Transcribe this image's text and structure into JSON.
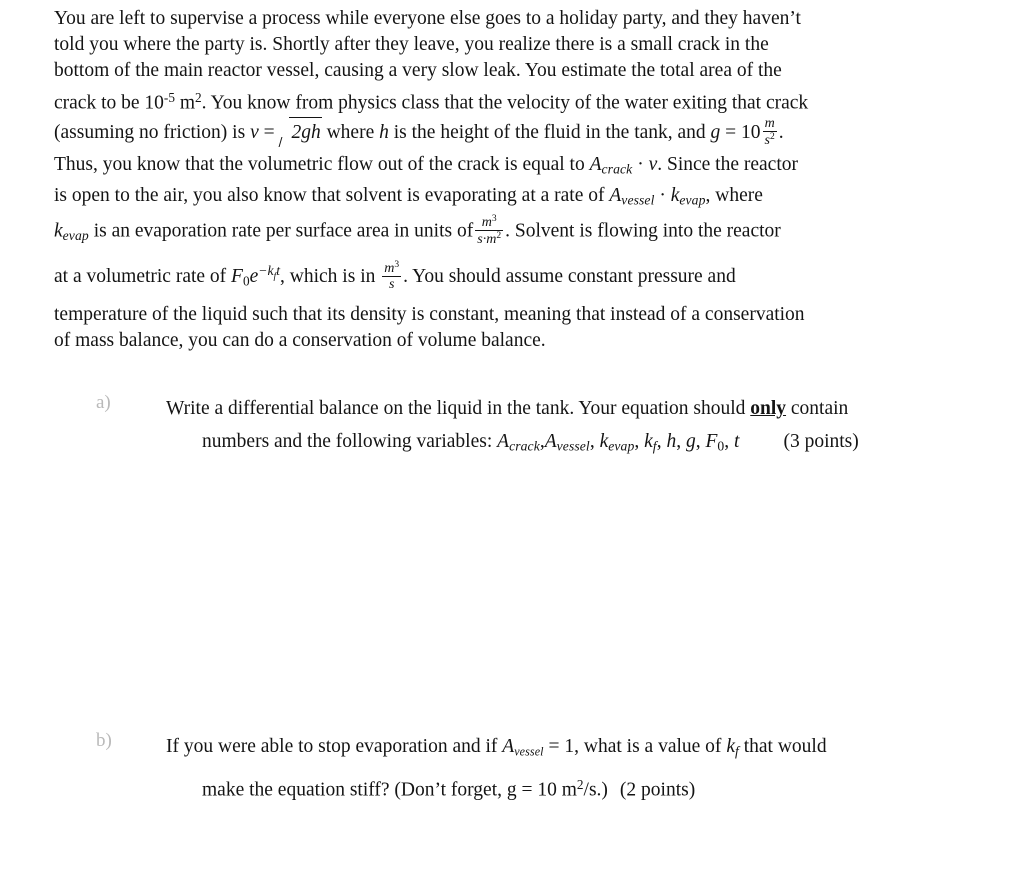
{
  "document": {
    "type": "exam-question-page",
    "problem_statement": {
      "lines": [
        "You are left to supervise a process while everyone else goes to a holiday party, and they haven’t",
        "told you where the party is.  Shortly after they leave, you realize there is a small crack in the",
        "bottom of the main reactor vessel, causing a very slow leak. You estimate the total area of the",
        "crack to be 10⁻⁵ m². You know from physics class that the velocity of the water exiting that crack",
        "(assuming no friction) is v = √(2gh) where h is the height of the fluid in the tank, and g = 10 m/s².",
        "Thus, you know that the volumetric flow out of the crack is equal to A_crack · v. Since the reactor",
        "is open to the air, you also know that solvent is evaporating at a rate of A_vessel · k_evap, where",
        "k_evap is an evaporation rate per surface area in units of m³/(s·m²). Solvent is flowing into the reactor",
        "at a volumetric rate of F₀e⁻ᵏᶠᵗ, which is in m³/s. You should assume constant pressure and",
        "temperature of the liquid such that its density is constant, meaning that instead of a conservation",
        "of mass balance, you can do a conservation of volume balance."
      ],
      "segments": {
        "l1": "You are left to supervise a process while everyone else goes to a holiday party, and they haven’t",
        "l2": "told you where the party is.  Shortly after they leave, you realize there is a small crack in the",
        "l3": "bottom of the main reactor vessel, causing a very slow leak. You estimate the total area of the",
        "l4a": "crack to be 10",
        "l4b": "-5",
        "l4c": " m",
        "l4d": "2",
        "l4e": ". You know from physics class that the velocity of the water exiting that crack",
        "l5a": "(assuming no friction) is ",
        "l5_v": "v",
        "l5_eq": " = ",
        "l5_rad": "2gh",
        "l5b": " where ",
        "l5_h": "h",
        "l5c": " is the height of the fluid in the tank, and ",
        "l5_g": "g",
        "l5d": " = 10",
        "l5_num": "m",
        "l5_den": "s",
        "l5_den_sup": "2",
        "l5e": ".",
        "l6a": "Thus, you know that the volumetric flow out of the crack is equal to ",
        "l6_A": "A",
        "l6_sub": "crack",
        "l6b": " · ",
        "l6_v": "v",
        "l6c": ". Since the reactor",
        "l7a": "is open to the air, you also know that solvent is evaporating at a rate of ",
        "l7_A": "A",
        "l7_sub": "vessel",
        "l7b": " · ",
        "l7_k": "k",
        "l7_ksub": "evap",
        "l7c": ", where",
        "l8_k": "k",
        "l8_ksub": "evap",
        "l8a": " is an evaporation rate per surface area in units of",
        "l8_num": "m",
        "l8_num_sup": "3",
        "l8_den": "s·m",
        "l8_den_sup": "2",
        "l8b": ".  Solvent is flowing into the reactor",
        "l9a": "at a volumetric rate of ",
        "l9_F": "F",
        "l9_Fsub": "0",
        "l9_e": "e",
        "l9_esup": "−k",
        "l9_esup_sub": "f",
        "l9_esup2": "t",
        "l9b": ", which is in ",
        "l9_num": "m",
        "l9_num_sup": "3",
        "l9_den": "s",
        "l9c": ". You should assume constant pressure and",
        "l10": "temperature of the liquid such that its density is constant, meaning that instead of a conservation",
        "l11": "of mass balance, you can do a conservation of volume balance."
      }
    },
    "questions": [
      {
        "marker": "a)",
        "line1_pre": "Write a differential balance on the liquid in the tank. Your equation should ",
        "line1_emph": "only",
        "line1_post": " contain",
        "line2_pre": "numbers and the following variables: ",
        "variables": [
          {
            "base": "A",
            "sub": "crack"
          },
          {
            "base": "A",
            "sub": "vessel"
          },
          {
            "base": "k",
            "sub": "evap"
          },
          {
            "base": "k",
            "sub": "f"
          },
          {
            "base": "h",
            "sub": ""
          },
          {
            "base": "g",
            "sub": ""
          },
          {
            "base": "F",
            "sub": "0"
          },
          {
            "base": "t",
            "sub": ""
          }
        ],
        "points": "(3 points)"
      },
      {
        "marker": "b)",
        "line1_a": "If you were able to stop evaporation and if ",
        "line1_A": "A",
        "line1_Asub": "vessel",
        "line1_b": " = 1, what is a value of ",
        "line1_k": "k",
        "line1_ksub": "f",
        "line1_c": " that would",
        "line2_a": "make the equation stiff? (Don’t forget, g = 10 m",
        "line2_sup": "2",
        "line2_b": "/s.)",
        "points": "(2 points)"
      }
    ]
  }
}
